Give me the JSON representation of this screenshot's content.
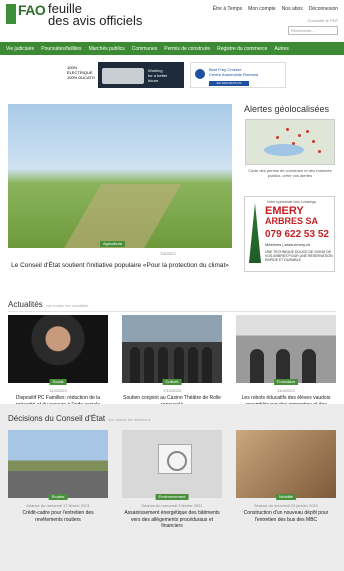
{
  "header": {
    "logo_mark": "FAO",
    "logo_title": "feuille\ndes avis officiels",
    "top_links": [
      "Être à Temps",
      "Mon compte",
      "Nos abos",
      "Déconnexion"
    ],
    "tiny_link": "Consulter le PDF",
    "search_placeholder": "Rechercher..."
  },
  "nav": {
    "items": [
      "Vie judiciaire",
      "Poursuites/faillites",
      "Marchés publics",
      "Communes",
      "Permis de construire",
      "Registre du commerce",
      "Autres"
    ]
  },
  "ads": {
    "left_strip": "100% ÉLECTRIQUE\n100% DUCATO",
    "left_text": "Working\nfor a better\nfuture.",
    "right_title": "Best Frey Crosser\nCentre Automobile Romand",
    "right_btn": "EN SAVOIR PLUS"
  },
  "hero": {
    "tag": "Agriculture",
    "date": "7/4/2023",
    "title": "Le Conseil d'État soutient l'initiative populaire «Pour la protection du climat»"
  },
  "sidebar": {
    "title": "Alertes géolocalisées",
    "map_caption": "Carte des permis de construire et des marchés publics, créer vos alertes",
    "emery": {
      "small": "Votre spécialiste bois Lobsiniga",
      "name": "EMERY",
      "sub": "ARBRES SA",
      "phone": "079 622 53 52",
      "web": "Mézières | www.emery.ch",
      "note": "UNE TECHNIQUE DOUCE DE SOINS DE VOS ARBRES POUR UNE RÉSERVATION RAPIDE ET DURABLE"
    }
  },
  "actualites": {
    "title": "Actualités",
    "hint": "voir toutes les actualités",
    "cards": [
      {
        "tag": "Social",
        "date": "11/4/2023",
        "title": "Dispositif PC Familles: réduction de la précarité et du recours à l'aide sociale"
      },
      {
        "tag": "Culture",
        "date": "7/12/2023",
        "title": "Soutien conjoint au Casino Théâtre de Rolle renouvelé"
      },
      {
        "tag": "Formation",
        "date": "11/4/2023",
        "title": "Les robots éducatifs des élèves vaudois assemblés par des apprenties et des apprentis du canton"
      }
    ]
  },
  "decisions": {
    "title": "Décisions du Conseil d'État",
    "hint": "voir toutes les décisions",
    "cards": [
      {
        "tag": "Routes",
        "date": "Séance du mercredi 17 février 2021",
        "title": "Crédit-cadre pour l'entretien des revêtements routiers"
      },
      {
        "tag": "Environnement",
        "date": "Séance du mercredi 3 février 2021",
        "title": "Assainissement énergétique des bâtiments vers des allègements procéduraux et financiers"
      },
      {
        "tag": "Mobilité",
        "date": "Séance du mercredi 20 janvier 2021",
        "title": "Construction d'un nouveau dépôt pour l'entretien des bus des MBC"
      }
    ]
  }
}
